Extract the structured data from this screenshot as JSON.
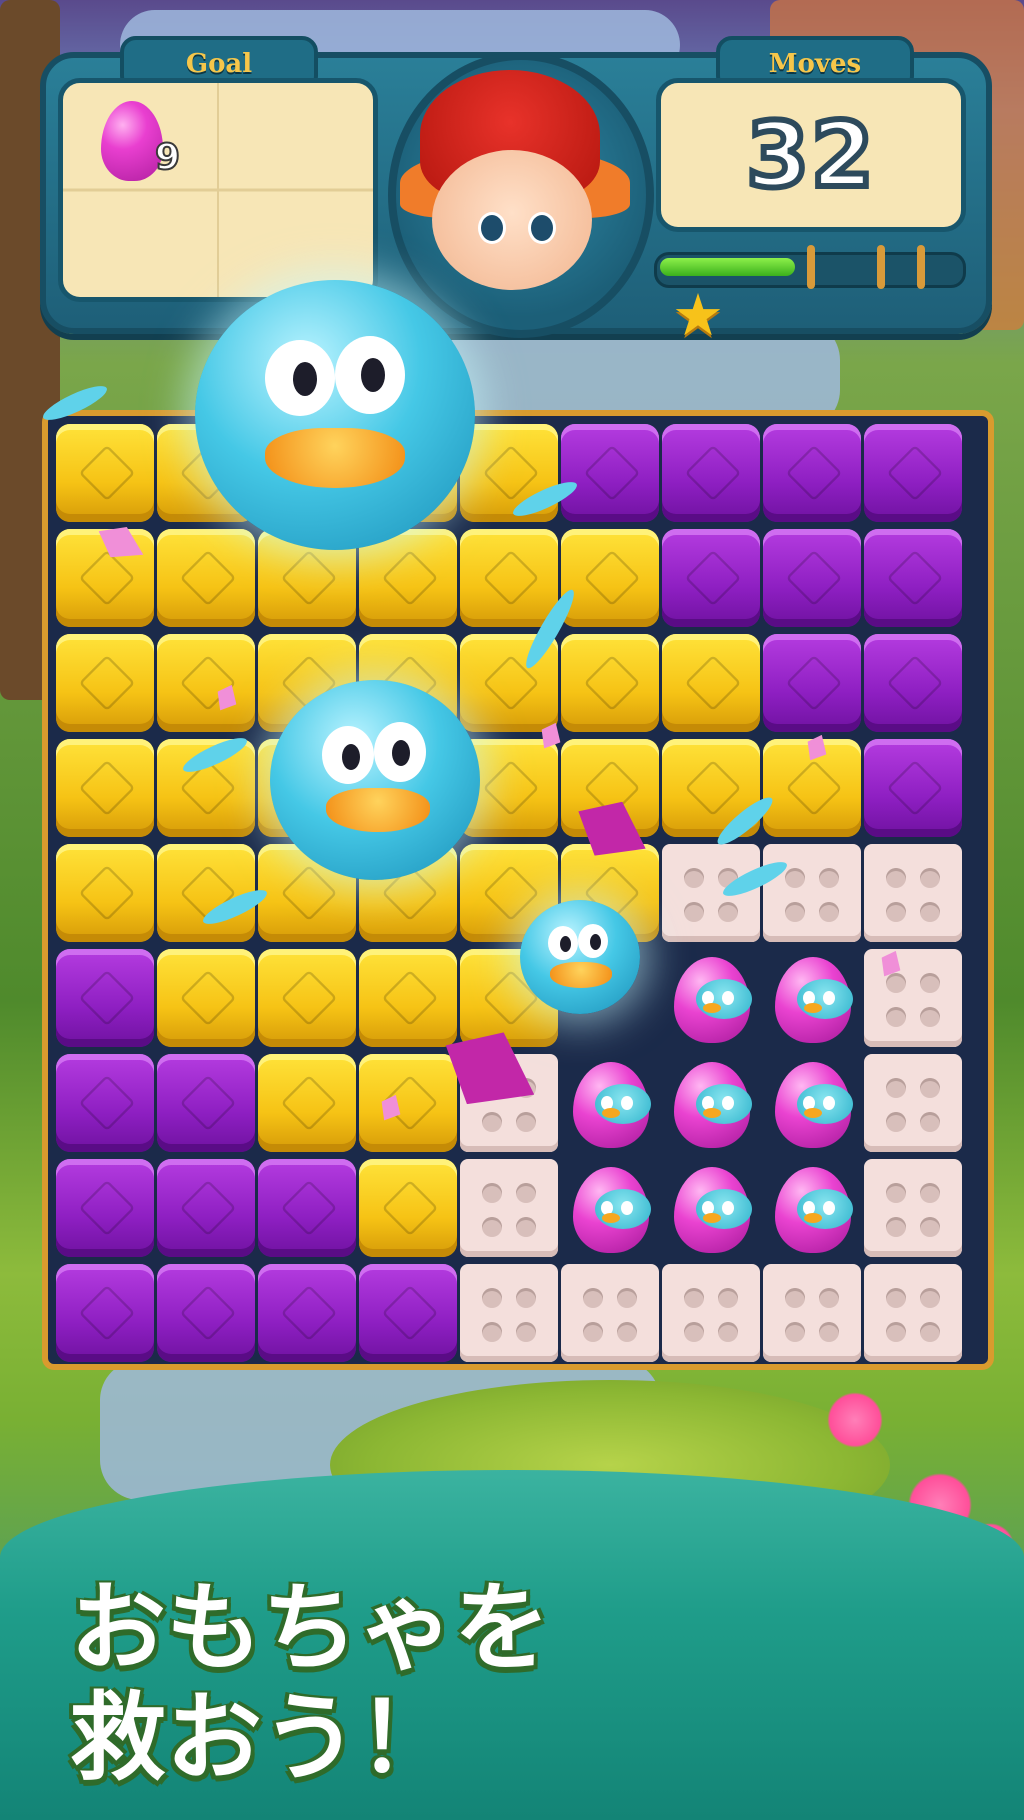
{
  "hud": {
    "goal_label": "Goal",
    "moves_label": "Moves",
    "goal_icon": "pink-egg-icon",
    "goal_count": "9",
    "moves_value": "32",
    "progress": 0.45,
    "star_icon": "star-icon"
  },
  "banner": {
    "line1": "おもちゃを",
    "line2": "救おう！"
  },
  "colors": {
    "yellow_block": "#f6c315",
    "purple_block": "#8e1fc2",
    "brick": "#f4dfdc",
    "egg": "#ea43d1",
    "banner": "#1f9d8a",
    "text_outline": "#2f6b2a"
  },
  "board": {
    "rows": [
      "YYYYYPPPP",
      "YYYYYYPPP",
      "YYYYYYYPP",
      "YYYYYYYYP",
      "YYYYYYBBB",
      "PYYYYXEEB",
      "PPYYBEEEB",
      "PPPYBEEEB",
      "PPPPBBBBB"
    ],
    "legend": {
      "Y": "yellow-cube",
      "P": "purple-cube",
      "B": "toy-brick",
      "E": "egg-with-chick",
      "X": "empty"
    }
  }
}
